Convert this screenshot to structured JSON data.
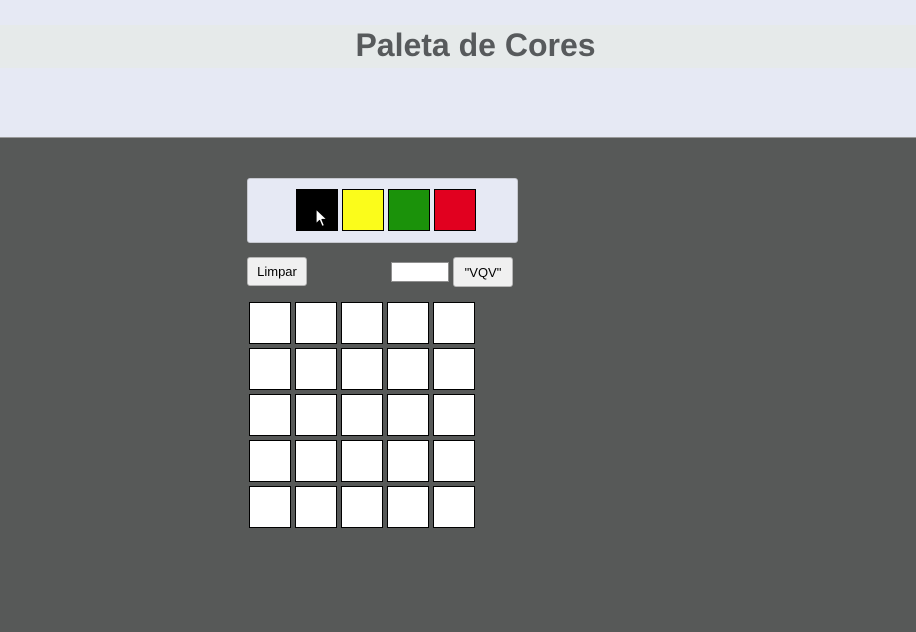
{
  "header": {
    "title": "Paleta de Cores",
    "background": "#e6e9f4"
  },
  "palette": {
    "colors": [
      {
        "name": "black",
        "hex": "#000000",
        "selected": true
      },
      {
        "name": "yellow",
        "hex": "#fbfc1b"
      },
      {
        "name": "green",
        "hex": "#1b920a"
      },
      {
        "name": "red",
        "hex": "#e1001f"
      }
    ]
  },
  "controls": {
    "clear_label": "Limpar",
    "board_size_value": "",
    "vqv_label": "\"VQV\""
  },
  "board": {
    "rows": 5,
    "cols": 5,
    "pixels": [
      "#ffffff",
      "#ffffff",
      "#ffffff",
      "#ffffff",
      "#ffffff",
      "#ffffff",
      "#ffffff",
      "#ffffff",
      "#ffffff",
      "#ffffff",
      "#ffffff",
      "#ffffff",
      "#ffffff",
      "#ffffff",
      "#ffffff",
      "#ffffff",
      "#ffffff",
      "#ffffff",
      "#ffffff",
      "#ffffff",
      "#ffffff",
      "#ffffff",
      "#ffffff",
      "#ffffff",
      "#ffffff"
    ]
  },
  "page": {
    "background": "#575958"
  },
  "cursor": {
    "icon": "mouse-pointer-icon"
  }
}
